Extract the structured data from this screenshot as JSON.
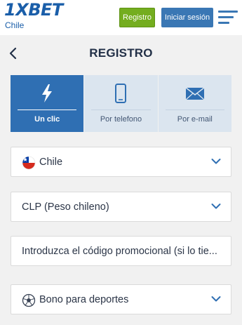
{
  "header": {
    "logo_text": "1XBET",
    "logo_region": "Chile",
    "register_label": "Registro",
    "login_label": "Iniciar sesión",
    "menu_icon": "hamburger-icon",
    "colors": {
      "brand": "#1a5ea9",
      "register": "#74ad1f",
      "login": "#3a77b4"
    }
  },
  "page": {
    "title": "REGISTRO",
    "back_icon": "back-arrow-icon"
  },
  "tabs": [
    {
      "label": "Un clic",
      "icon": "lightning-icon",
      "active": true
    },
    {
      "label": "Por telefono",
      "icon": "phone-icon",
      "active": false
    },
    {
      "label": "Por e-mail",
      "icon": "envelope-icon",
      "active": false
    }
  ],
  "form": {
    "country": {
      "value": "Chile",
      "icon": "chile-flag-icon"
    },
    "currency": {
      "value": "CLP (Peso chileno)"
    },
    "promo": {
      "placeholder": "Introduzca el código promocional (si lo tie..."
    },
    "bonus": {
      "value": "Bono para deportes",
      "icon": "soccer-ball-icon"
    }
  }
}
